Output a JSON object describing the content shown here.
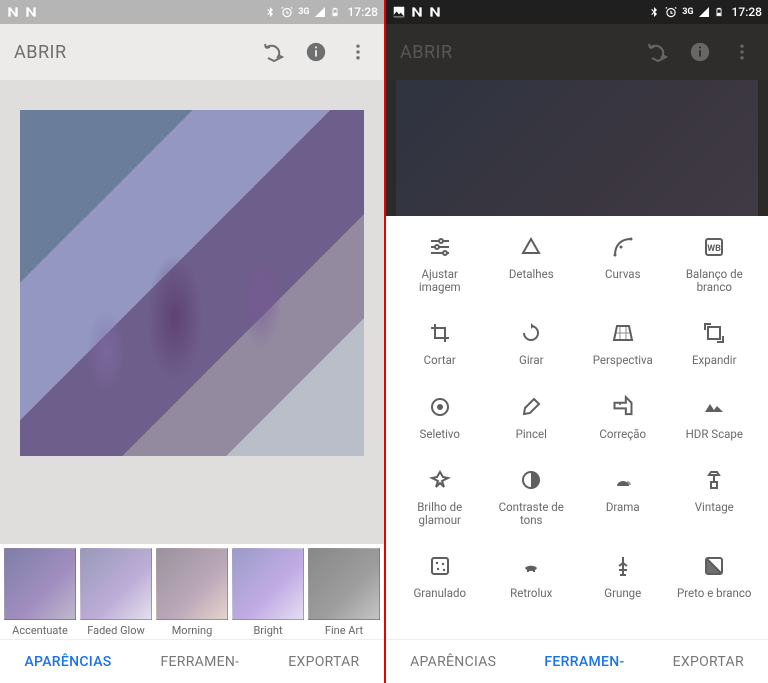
{
  "status": {
    "time": "17:28",
    "network_label": "3G"
  },
  "left": {
    "open_label": "ABRIR",
    "looks": [
      {
        "label": "Accentuate"
      },
      {
        "label": "Faded Glow"
      },
      {
        "label": "Morning"
      },
      {
        "label": "Bright"
      },
      {
        "label": "Fine Art"
      }
    ],
    "tabs": {
      "looks": "APARÊNCIAS",
      "tools": "FERRAMEN-",
      "export": "EXPORTAR"
    }
  },
  "right": {
    "open_label": "ABRIR",
    "tools": [
      {
        "label": "Ajustar imagem",
        "icon": "tune"
      },
      {
        "label": "Detalhes",
        "icon": "details"
      },
      {
        "label": "Curvas",
        "icon": "curves"
      },
      {
        "label": "Balanço de branco",
        "icon": "wb"
      },
      {
        "label": "Cortar",
        "icon": "crop"
      },
      {
        "label": "Girar",
        "icon": "rotate"
      },
      {
        "label": "Perspectiva",
        "icon": "perspective"
      },
      {
        "label": "Expandir",
        "icon": "expand"
      },
      {
        "label": "Seletivo",
        "icon": "selective"
      },
      {
        "label": "Pincel",
        "icon": "brush"
      },
      {
        "label": "Correção",
        "icon": "healing"
      },
      {
        "label": "HDR Scape",
        "icon": "hdr"
      },
      {
        "label": "Brilho de glamour",
        "icon": "glamour"
      },
      {
        "label": "Contraste de tons",
        "icon": "tonal"
      },
      {
        "label": "Drama",
        "icon": "drama"
      },
      {
        "label": "Vintage",
        "icon": "vintage"
      },
      {
        "label": "Granulado",
        "icon": "grainy"
      },
      {
        "label": "Retrolux",
        "icon": "retrolux"
      },
      {
        "label": "Grunge",
        "icon": "grunge"
      },
      {
        "label": "Preto e branco",
        "icon": "bw"
      }
    ],
    "tabs": {
      "looks": "APARÊNCIAS",
      "tools": "FERRAMEN-",
      "export": "EXPORTAR"
    }
  }
}
